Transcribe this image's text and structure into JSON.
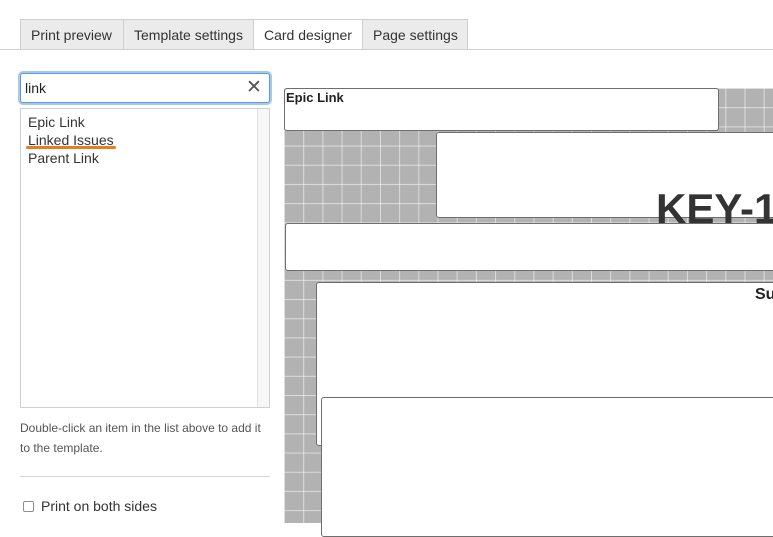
{
  "tabs": [
    {
      "label": "Print preview",
      "active": false
    },
    {
      "label": "Template settings",
      "active": false
    },
    {
      "label": "Card designer",
      "active": true
    },
    {
      "label": "Page settings",
      "active": false
    }
  ],
  "search": {
    "value": "link",
    "clear_icon": "close-icon"
  },
  "fields_list": {
    "items": [
      "Epic Link",
      "Linked Issues",
      "Parent Link"
    ],
    "highlight_color": "#f07a1a"
  },
  "help_text": "Double-click an item in the list above to add it to the template.",
  "print_both_sides": {
    "label": "Print on both sides",
    "checked": false
  },
  "designer": {
    "epic_link_label": "Epic Link",
    "key_text": "KEY-1",
    "summary_label_partial": "Su"
  },
  "colors": {
    "accent_focus": "#5b9dd9",
    "canvas_bg": "#b2b2b2"
  }
}
